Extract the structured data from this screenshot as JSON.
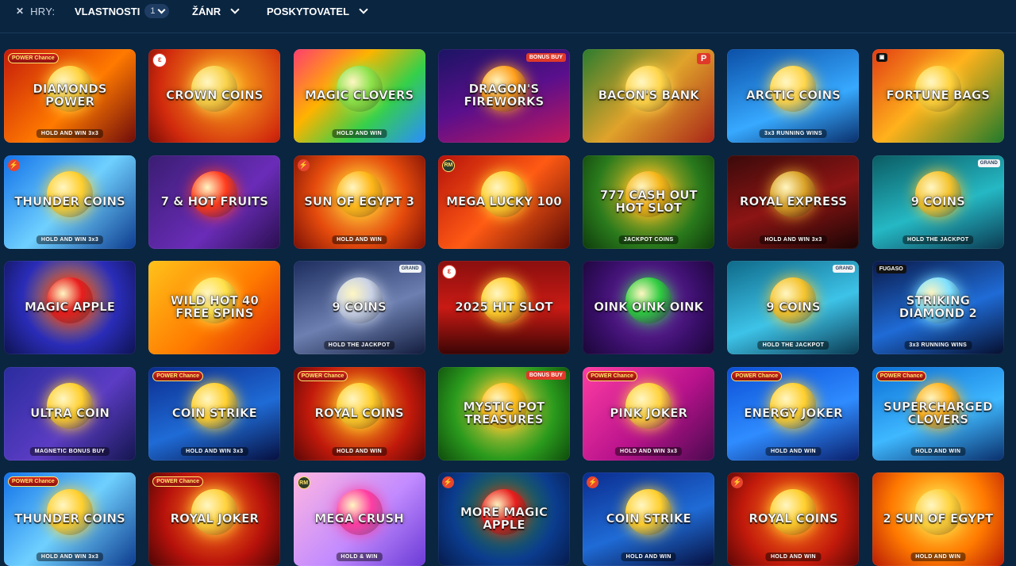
{
  "filters": {
    "games_label": "HRY:",
    "properties_label": "VLASTNOSTI",
    "properties_count": "1",
    "genre_label": "ŽÁNR",
    "provider_label": "POSKYTOVATEL"
  },
  "games": [
    {
      "title": "Diamonds Power",
      "sub": "HOLD AND WIN 3x3",
      "badge": "POWER Chance",
      "bg": "linear-gradient(135deg,#c51b0b,#ff7a00 55%,#6e0b0b)",
      "orb": "#ffd23d"
    },
    {
      "title": "Crown Coins",
      "sub": "",
      "badge": "ε",
      "bg": "radial-gradient(circle at 60% 40%,#ffb21c,#d12a0d 70%,#7c0c06)",
      "orb": "#f9d24a"
    },
    {
      "title": "Magic Clovers",
      "sub": "HOLD AND WIN",
      "badge": "",
      "bg": "linear-gradient(135deg,#ff3d6e,#ffb300 35%,#35d04a 65%,#2a8dff)",
      "orb": "#8be24a"
    },
    {
      "title": "Dragon's Fireworks",
      "sub": "",
      "badge": "",
      "corner": "BONUS BUY",
      "bg": "linear-gradient(160deg,#1b1464,#5a0f8c 50%,#c2185b)",
      "orb": "#ff9f1c"
    },
    {
      "title": "Bacon's Bank",
      "sub": "",
      "badge": "",
      "corner": "P",
      "bg": "linear-gradient(135deg,#2c7c2e,#e0a32b 50%,#a82418)",
      "orb": "#ffd54a"
    },
    {
      "title": "Arctic Coins",
      "sub": "3x3 RUNNING WINS",
      "badge": "",
      "bg": "linear-gradient(160deg,#0b4fa7,#37a9ff 60%,#0a2f6b)",
      "orb": "#ffd54a"
    },
    {
      "title": "Fortune Bags",
      "sub": "",
      "badge": "▣",
      "bg": "linear-gradient(135deg,#e23d14,#ffb21c 45%,#1f7a2b)",
      "orb": "#ffd23d"
    },
    {
      "title": "Thunder Coins",
      "sub": "HOLD AND WIN 3x3",
      "badge": "⚡",
      "bg": "linear-gradient(135deg,#1372e8,#6fd0ff 50%,#0d3b8e)",
      "orb": "#ffcf2e"
    },
    {
      "title": "7 & Hot Fruits",
      "sub": "",
      "badge": "",
      "bg": "linear-gradient(135deg,#3a1d72,#6a2cb8 60%,#2a0f4f)",
      "orb": "#ff3b1d"
    },
    {
      "title": "Sun of Egypt 3",
      "sub": "HOLD AND WIN",
      "badge": "⚡",
      "bg": "radial-gradient(circle at 50% 45%,#ffd34a,#e54b0c 55%,#7a0f06)",
      "orb": "#ffb81a"
    },
    {
      "title": "Mega Lucky 100",
      "sub": "",
      "badge": "RM",
      "bg": "linear-gradient(135deg,#b5120b,#ff5a14 50%,#5a0a05)",
      "orb": "#ffcf2e"
    },
    {
      "title": "777 Cash Out Hot Slot",
      "sub": "JACKPOT COINS",
      "badge": "",
      "bg": "radial-gradient(circle at 50% 40%,#f6c52b,#2a7a1c 60%,#0e3b0c)",
      "orb": "#f6b61a"
    },
    {
      "title": "Royal Express",
      "sub": "HOLD AND WIN 3x3",
      "badge": "",
      "bg": "linear-gradient(160deg,#3a0a0a,#8c1414 50%,#1a0505)",
      "orb": "#d9a227"
    },
    {
      "title": "9 Coins",
      "sub": "HOLD THE JACKPOT",
      "badge": "",
      "corner": "GRAND",
      "bg": "linear-gradient(160deg,#0b5c63,#25b8c4 55%,#0b3a52)",
      "orb": "#f4c22c"
    },
    {
      "title": "Magic Apple",
      "sub": "",
      "badge": "",
      "bg": "radial-gradient(circle at 50% 40%,#ff9f1c,#2a2cb8 55%,#0e1350)",
      "orb": "#e81d1d"
    },
    {
      "title": "Wild Hot 40 Free Spins",
      "sub": "",
      "badge": "",
      "bg": "linear-gradient(135deg,#ffc21a,#ff7a00 55%,#d81e0b)",
      "orb": "#ffe14a"
    },
    {
      "title": "9 Coins",
      "sub": "HOLD THE JACKPOT",
      "badge": "",
      "corner": "GRAND",
      "bg": "linear-gradient(160deg,#1c2d5e,#6c7fb0 55%,#121c3d)",
      "orb": "#c9d2e6"
    },
    {
      "title": "2025 Hit Slot",
      "sub": "",
      "badge": "ε",
      "bg": "linear-gradient(180deg,#8a0f0f,#c91a14 50%,#3a0505)",
      "orb": "#ffcf2e"
    },
    {
      "title": "Oink Oink Oink",
      "sub": "",
      "badge": "",
      "bg": "radial-gradient(circle at 50% 45%,#7b2cb8,#3a0f6b 60%,#1a0636)",
      "orb": "#2ecc40"
    },
    {
      "title": "9 Coins",
      "sub": "HOLD THE JACKPOT",
      "badge": "",
      "corner": "GRAND",
      "bg": "linear-gradient(160deg,#0f6a8a,#3dc3e8 55%,#0b3a52)",
      "orb": "#f4c22c"
    },
    {
      "title": "Striking Diamond 2",
      "sub": "3x3 RUNNING WINS",
      "badge": "FUGASO",
      "bg": "linear-gradient(160deg,#0a1a4a,#1f6bd6 55%,#060f2e)",
      "orb": "#7ee0ff"
    },
    {
      "title": "Ultra Coin",
      "sub": "MAGNETIC BONUS BUY",
      "badge": "",
      "bg": "linear-gradient(135deg,#2a2c9e,#5b3cc4 55%,#14164f)",
      "orb": "#ffcf2e"
    },
    {
      "title": "Coin Strike",
      "sub": "HOLD AND WIN 3x3",
      "badge": "POWER Chance",
      "bg": "linear-gradient(160deg,#0b2c8e,#1f6bd6 55%,#060f3e)",
      "orb": "#ffcf2e"
    },
    {
      "title": "Royal Coins",
      "sub": "HOLD AND WIN",
      "badge": "POWER Chance",
      "bg": "radial-gradient(circle at 50% 45%,#ffb21c,#c21a0b 60%,#5a0606)",
      "orb": "#ffcf2e"
    },
    {
      "title": "Mystic Pot Treasures",
      "sub": "",
      "badge": "",
      "corner": "BONUS BUY",
      "bg": "radial-gradient(circle at 50% 45%,#ffd54a,#2a9a1c 60%,#0e4a0c)",
      "orb": "#ffbf1a"
    },
    {
      "title": "Pink Joker",
      "sub": "HOLD AND WIN 3x3",
      "badge": "POWER Chance",
      "bg": "linear-gradient(135deg,#ff3da3,#b8128c 55%,#4a0a4f)",
      "orb": "#ffd23d"
    },
    {
      "title": "Energy Joker",
      "sub": "HOLD AND WIN",
      "badge": "POWER Chance",
      "bg": "linear-gradient(160deg,#0b4fd6,#2f8cff 55%,#0a1f6b)",
      "orb": "#ffcf2e"
    },
    {
      "title": "Supercharged Clovers",
      "sub": "HOLD AND WIN",
      "badge": "POWER Chance",
      "bg": "linear-gradient(160deg,#0b6fd6,#3fb8ff 55%,#0a2f6b)",
      "orb": "#ffb21c"
    },
    {
      "title": "Thunder Coins",
      "sub": "HOLD AND WIN 3x3",
      "badge": "POWER Chance",
      "bg": "linear-gradient(135deg,#1372e8,#6fd0ff 50%,#0d3b8e)",
      "orb": "#ffcf2e"
    },
    {
      "title": "Royal Joker",
      "sub": "",
      "badge": "POWER Chance",
      "bg": "radial-gradient(circle at 50% 45%,#ff7a1a,#b8120b 60%,#4a0505)",
      "orb": "#ffd23d"
    },
    {
      "title": "Mega Crush",
      "sub": "HOLD & WIN",
      "badge": "RM",
      "bg": "linear-gradient(135deg,#ffb6e0,#c28bff 55%,#6a3ad6)",
      "orb": "#ff3da3"
    },
    {
      "title": "More Magic Apple",
      "sub": "",
      "badge": "⚡",
      "bg": "radial-gradient(circle at 50% 40%,#2f8c2a,#0b3c8e 60%,#061a4a)",
      "orb": "#e81d1d"
    },
    {
      "title": "Coin Strike",
      "sub": "HOLD AND WIN",
      "badge": "⚡",
      "bg": "linear-gradient(160deg,#0b2c8e,#1f6bd6 55%,#060f3e)",
      "orb": "#ffcf2e"
    },
    {
      "title": "Royal Coins",
      "sub": "HOLD AND WIN",
      "badge": "⚡",
      "bg": "radial-gradient(circle at 50% 45%,#ff7a1a,#c21a0b 60%,#5a0606)",
      "orb": "#ffcf2e"
    },
    {
      "title": "2 Sun of Egypt",
      "sub": "HOLD AND WIN",
      "badge": "",
      "bg": "radial-gradient(circle at 50% 40%,#ffe14a,#ff7a00 55%,#b81a05)",
      "orb": "#ffd23d"
    }
  ]
}
